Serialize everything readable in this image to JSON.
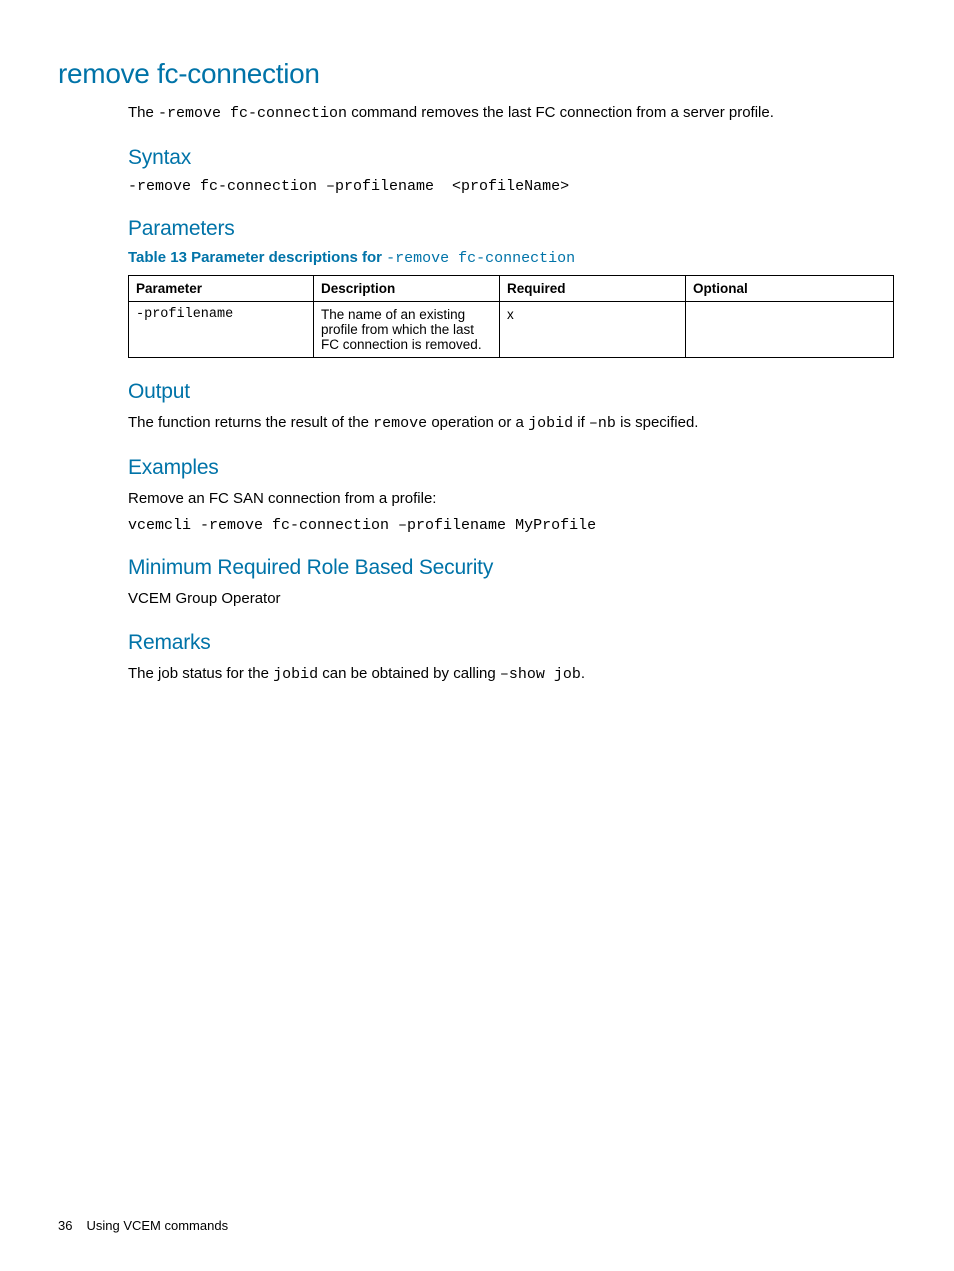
{
  "title": "remove fc-connection",
  "intro_parts": {
    "pre": "The ",
    "code": "-remove fc-connection",
    "post": " command removes the last FC connection from a server profile."
  },
  "syntax": {
    "heading": "Syntax",
    "code": "-remove fc-connection –profilename  <profileName>"
  },
  "parameters": {
    "heading": "Parameters",
    "caption_prefix": "Table 13 Parameter descriptions for ",
    "caption_code": "-remove fc-connection",
    "headers": {
      "parameter": "Parameter",
      "description": "Description",
      "required": "Required",
      "optional": "Optional"
    },
    "rows": [
      {
        "parameter": "-profilename",
        "description": "The name of an existing profile from which the last FC connection is removed.",
        "required": "x",
        "optional": ""
      }
    ]
  },
  "output": {
    "heading": "Output",
    "pre": "The function returns the result of the ",
    "code1": "remove",
    "mid1": " operation or a ",
    "code2": "jobid",
    "mid2": " if ",
    "code3": "–nb",
    "post": " is specified."
  },
  "examples": {
    "heading": "Examples",
    "intro": "Remove an FC SAN connection from a profile:",
    "code": "vcemcli -remove fc-connection –profilename MyProfile"
  },
  "security": {
    "heading": "Minimum Required Role Based Security",
    "body": "VCEM Group Operator"
  },
  "remarks": {
    "heading": "Remarks",
    "pre": "The job status for the ",
    "code1": "jobid",
    "mid": " can be obtained by calling ",
    "code2": "–show job",
    "post": "."
  },
  "footer": {
    "page": "36",
    "section": "Using VCEM commands"
  }
}
